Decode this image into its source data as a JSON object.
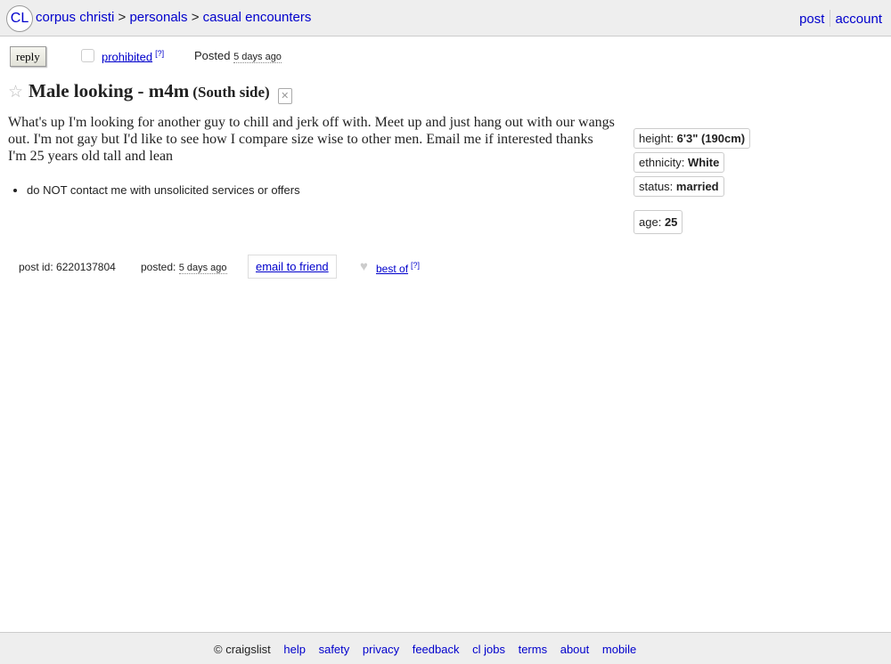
{
  "header": {
    "logo": "CL",
    "breadcrumbs": [
      "corpus christi",
      "personals",
      "casual encounters"
    ],
    "separator": ">",
    "links": [
      "post",
      "account"
    ]
  },
  "actions": {
    "reply_label": "reply",
    "prohibited_label": "prohibited",
    "help_mark": "[?]",
    "posted_label": "Posted",
    "posted_ago": "5 days ago"
  },
  "posting": {
    "title": "Male looking - m4m",
    "location": "(South side)",
    "body_lines": [
      "What's up I'm looking for another guy to chill and jerk off with. Meet up and just hang out with our wangs out. I'm not gay but I'd like to see how I compare size wise to other men. Email me if interested thanks",
      "I'm 25 years old tall and lean"
    ],
    "notices": [
      "do NOT contact me with unsolicited services or offers"
    ]
  },
  "attributes": [
    {
      "label": "height:",
      "value": "6'3\" (190cm)"
    },
    {
      "label": "ethnicity:",
      "value": "White"
    },
    {
      "label": "status:",
      "value": "married"
    },
    {
      "label": "age:",
      "value": "25"
    }
  ],
  "postinfo": {
    "post_id_label": "post id:",
    "post_id": "6220137804",
    "posted_label": "posted:",
    "posted_ago": "5 days ago",
    "email_friend": "email to friend",
    "best_of": "best of",
    "help_mark": "[?]"
  },
  "footer": {
    "copyright": "© craigslist",
    "links": [
      "help",
      "safety",
      "privacy",
      "feedback",
      "cl jobs",
      "terms",
      "about",
      "mobile"
    ]
  },
  "icons": {
    "star": "star-icon",
    "hide": "hide-icon",
    "heart": "heart-icon",
    "flag": "flag-checkbox"
  }
}
